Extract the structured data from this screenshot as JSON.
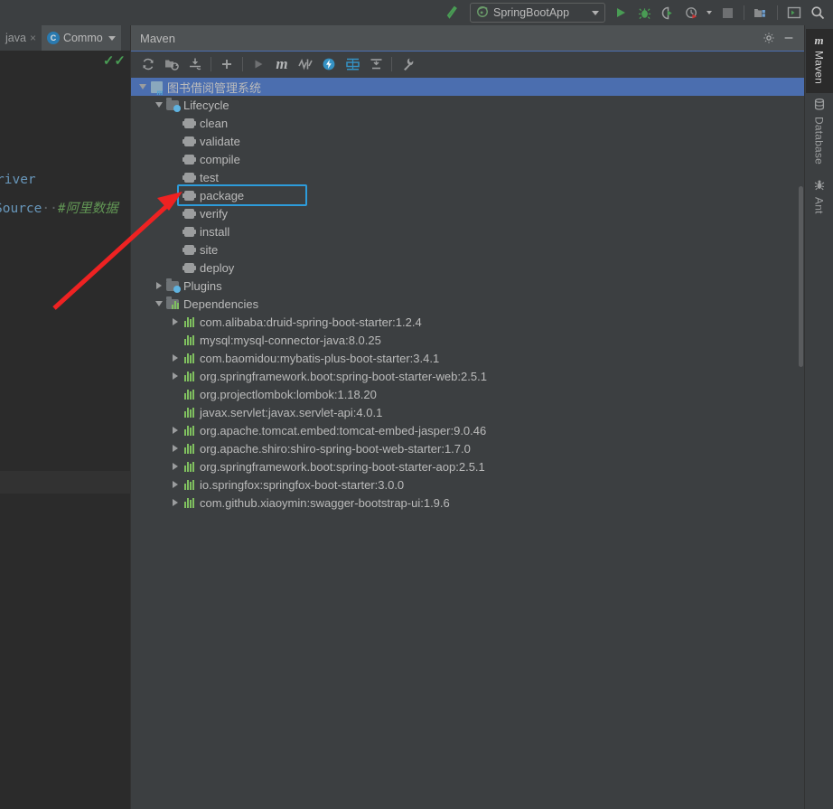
{
  "window": {
    "ide_theme": "darcula",
    "accent_blue": "#4b6eaf",
    "highlight_box_color": "#2d9cdb",
    "annotation_arrow_color": "#ee2222"
  },
  "top_toolbar": {
    "build_icon": "hammer-icon",
    "run_configuration": {
      "icon": "spring-boot-icon",
      "label": "SpringBootApp",
      "dropdown_icon": "chevron-down-icon"
    },
    "buttons": [
      {
        "name": "run-button",
        "icon": "play-icon",
        "color": "#499c54"
      },
      {
        "name": "debug-button",
        "icon": "bug-icon",
        "color": "#499c54"
      },
      {
        "name": "run-with-coverage-button",
        "icon": "coverage-icon",
        "color": "#9b9d9e"
      },
      {
        "name": "profiler-button",
        "icon": "profiler-clock-icon",
        "color": "#9b9d9e"
      },
      {
        "name": "stop-button",
        "icon": "stop-square-icon",
        "color": "#6e7072"
      },
      {
        "name": "project-structure-button",
        "icon": "project-structure-icon",
        "color": "#9b9d9e"
      },
      {
        "name": "terminal-button",
        "icon": "terminal-window-icon",
        "color": "#9b9d9e"
      },
      {
        "name": "search-everywhere-button",
        "icon": "search-icon",
        "color": "#bbbbbb"
      }
    ]
  },
  "editor_tabs": [
    {
      "label": "java",
      "icon": "",
      "close_icon": "×",
      "active": false
    },
    {
      "label": "Commo",
      "icon": "C",
      "dropdown_icon": "chevron-down-icon",
      "active": true
    }
  ],
  "editor": {
    "inspection_badge": "green-check-icon",
    "lines": [
      {
        "text": "river",
        "style": "keyword"
      },
      {
        "text": "Source",
        "style": "keyword",
        "dots": "··",
        "comment": "#阿里数据"
      }
    ]
  },
  "maven_panel": {
    "title": "Maven",
    "header_icons": [
      {
        "name": "settings-gear-icon",
        "glyph": "gear"
      },
      {
        "name": "hide-panel-icon",
        "glyph": "minus"
      }
    ],
    "toolbar_icons": [
      {
        "name": "reload-all-maven-projects-icon",
        "glyph": "refresh"
      },
      {
        "name": "generate-sources-and-update-folders-icon",
        "glyph": "folder-refresh"
      },
      {
        "name": "download-sources-and-documentation-icon",
        "glyph": "download"
      },
      {
        "name": "add-maven-project-icon",
        "glyph": "plus"
      },
      {
        "name": "run-maven-build-icon",
        "glyph": "play-disabled"
      },
      {
        "name": "execute-maven-goal-icon",
        "glyph": "m"
      },
      {
        "name": "toggle-skip-tests-icon",
        "glyph": "skip-tests"
      },
      {
        "name": "toggle-offline-mode-icon",
        "glyph": "offline-bolt"
      },
      {
        "name": "show-dependencies-icon",
        "glyph": "dependencies-diagram"
      },
      {
        "name": "collapse-all-icon",
        "glyph": "collapse"
      },
      {
        "name": "maven-settings-icon",
        "glyph": "wrench"
      }
    ],
    "tree": [
      {
        "id": "root",
        "label": "图书借阅管理系统",
        "depth": 0,
        "icon": "maven-module-icon",
        "expander": "expanded",
        "selected": true
      },
      {
        "id": "lifecycle",
        "label": "Lifecycle",
        "depth": 1,
        "icon": "lifecycle-folder-icon",
        "expander": "expanded",
        "selected": false
      },
      {
        "id": "clean",
        "label": "clean",
        "depth": 2,
        "icon": "maven-goal-icon",
        "expander": "none",
        "selected": false
      },
      {
        "id": "validate",
        "label": "validate",
        "depth": 2,
        "icon": "maven-goal-icon",
        "expander": "none",
        "selected": false
      },
      {
        "id": "compile",
        "label": "compile",
        "depth": 2,
        "icon": "maven-goal-icon",
        "expander": "none",
        "selected": false
      },
      {
        "id": "test",
        "label": "test",
        "depth": 2,
        "icon": "maven-goal-icon",
        "expander": "none",
        "selected": false
      },
      {
        "id": "package",
        "label": "package",
        "depth": 2,
        "icon": "maven-goal-icon",
        "expander": "none",
        "selected": false,
        "highlighted": true
      },
      {
        "id": "verify",
        "label": "verify",
        "depth": 2,
        "icon": "maven-goal-icon",
        "expander": "none",
        "selected": false
      },
      {
        "id": "install",
        "label": "install",
        "depth": 2,
        "icon": "maven-goal-icon",
        "expander": "none",
        "selected": false
      },
      {
        "id": "site",
        "label": "site",
        "depth": 2,
        "icon": "maven-goal-icon",
        "expander": "none",
        "selected": false
      },
      {
        "id": "deploy",
        "label": "deploy",
        "depth": 2,
        "icon": "maven-goal-icon",
        "expander": "none",
        "selected": false
      },
      {
        "id": "plugins",
        "label": "Plugins",
        "depth": 1,
        "icon": "plugins-folder-icon",
        "expander": "collapsed",
        "selected": false
      },
      {
        "id": "dependencies",
        "label": "Dependencies",
        "depth": 1,
        "icon": "dependencies-folder-icon",
        "expander": "expanded",
        "selected": false
      },
      {
        "id": "dep1",
        "label": "com.alibaba:druid-spring-boot-starter:1.2.4",
        "depth": 2,
        "icon": "dependency-icon",
        "expander": "collapsed",
        "selected": false
      },
      {
        "id": "dep2",
        "label": "mysql:mysql-connector-java:8.0.25",
        "depth": 2,
        "icon": "dependency-icon",
        "expander": "none",
        "selected": false
      },
      {
        "id": "dep3",
        "label": "com.baomidou:mybatis-plus-boot-starter:3.4.1",
        "depth": 2,
        "icon": "dependency-icon",
        "expander": "collapsed",
        "selected": false
      },
      {
        "id": "dep4",
        "label": "org.springframework.boot:spring-boot-starter-web:2.5.1",
        "depth": 2,
        "icon": "dependency-icon",
        "expander": "collapsed",
        "selected": false
      },
      {
        "id": "dep5",
        "label": "org.projectlombok:lombok:1.18.20",
        "depth": 2,
        "icon": "dependency-icon",
        "expander": "none",
        "selected": false
      },
      {
        "id": "dep6",
        "label": "javax.servlet:javax.servlet-api:4.0.1",
        "depth": 2,
        "icon": "dependency-icon",
        "expander": "none",
        "selected": false
      },
      {
        "id": "dep7",
        "label": "org.apache.tomcat.embed:tomcat-embed-jasper:9.0.46",
        "depth": 2,
        "icon": "dependency-icon",
        "expander": "collapsed",
        "selected": false
      },
      {
        "id": "dep8",
        "label": "org.apache.shiro:shiro-spring-boot-web-starter:1.7.0",
        "depth": 2,
        "icon": "dependency-icon",
        "expander": "collapsed",
        "selected": false
      },
      {
        "id": "dep9",
        "label": "org.springframework.boot:spring-boot-starter-aop:2.5.1",
        "depth": 2,
        "icon": "dependency-icon",
        "expander": "collapsed",
        "selected": false
      },
      {
        "id": "dep10",
        "label": "io.springfox:springfox-boot-starter:3.0.0",
        "depth": 2,
        "icon": "dependency-icon",
        "expander": "collapsed",
        "selected": false
      },
      {
        "id": "dep11",
        "label": "com.github.xiaoymin:swagger-bootstrap-ui:1.9.6",
        "depth": 2,
        "icon": "dependency-icon",
        "expander": "collapsed",
        "selected": false
      }
    ]
  },
  "right_sidebar": [
    {
      "label": "Maven",
      "icon": "maven-m-icon",
      "active": true
    },
    {
      "label": "Database",
      "icon": "database-icon",
      "active": false
    },
    {
      "label": "Ant",
      "icon": "ant-bug-icon",
      "active": false
    }
  ]
}
